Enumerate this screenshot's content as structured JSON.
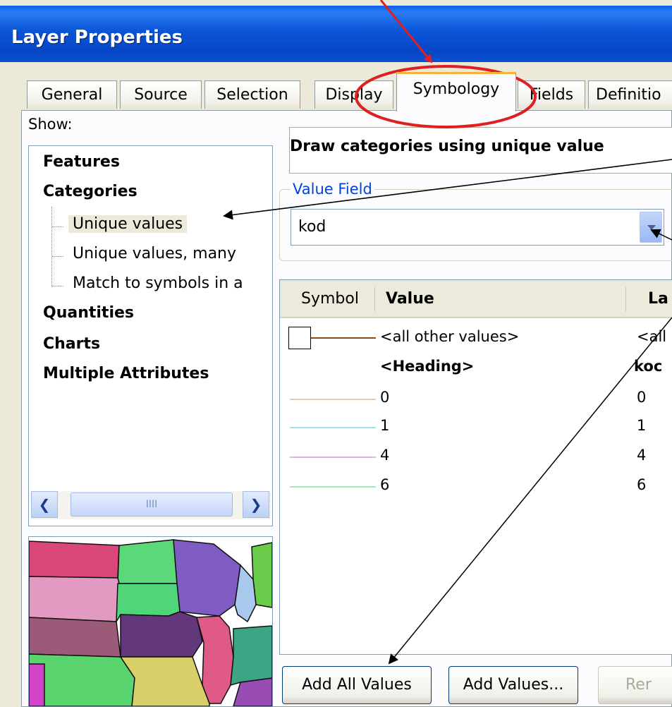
{
  "window": {
    "title": "Layer Properties"
  },
  "tabs": [
    {
      "label": "General"
    },
    {
      "label": "Source"
    },
    {
      "label": "Selection"
    },
    {
      "label": "Display"
    },
    {
      "label": "Symbology"
    },
    {
      "label": "Fields"
    },
    {
      "label": "Definitio"
    }
  ],
  "show": {
    "label": "Show:",
    "tree": {
      "features": "Features",
      "categories": "Categories",
      "unique_values": "Unique values",
      "unique_values_many": "Unique values, many",
      "match_symbols": "Match to symbols in a",
      "quantities": "Quantities",
      "charts": "Charts",
      "multiple_attributes": "Multiple Attributes"
    },
    "scroll_thumb_grip": "IIII"
  },
  "description": "Draw categories using unique value",
  "value_field": {
    "legend": "Value Field",
    "selected": "kod"
  },
  "symbol_list": {
    "headers": {
      "symbol": "Symbol",
      "value": "Value",
      "label": "La"
    },
    "rows": [
      {
        "value": "<all other values>",
        "label": "<all",
        "color": "#8b4a1c",
        "bold": false
      },
      {
        "value": "<Heading>",
        "label": "koc",
        "color": "",
        "bold": true
      },
      {
        "value": "0",
        "label": "0",
        "color": "#f5c9a8",
        "bold": false
      },
      {
        "value": "1",
        "label": "1",
        "color": "#a9e0f2",
        "bold": false
      },
      {
        "value": "4",
        "label": "4",
        "color": "#e3b0f0",
        "bold": false
      },
      {
        "value": "6",
        "label": "6",
        "color": "#a9ecb0",
        "bold": false
      }
    ]
  },
  "buttons": {
    "add_all_values": "Add All Values",
    "add_values": "Add Values...",
    "remove": "Rer"
  },
  "colors": {
    "title_bar": "#0a55d8",
    "dialog_bg": "#ece9d8",
    "active_tab_accent": "#f7b23e",
    "annotation_red": "#e02020"
  }
}
